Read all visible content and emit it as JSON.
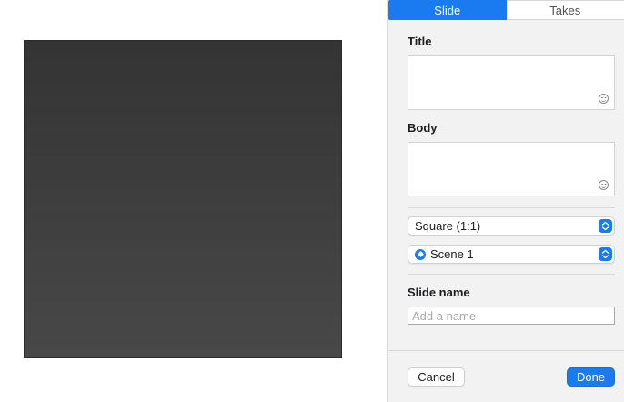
{
  "tabs": [
    {
      "label": "Slide",
      "active": true
    },
    {
      "label": "Takes",
      "active": false
    }
  ],
  "title_section": {
    "label": "Title",
    "value": ""
  },
  "body_section": {
    "label": "Body",
    "value": ""
  },
  "aspect_popup": {
    "value": "Square (1:1)"
  },
  "scene_popup": {
    "value": "Scene 1"
  },
  "slide_name": {
    "label": "Slide name",
    "value": "",
    "placeholder": "Add a name"
  },
  "footer": {
    "cancel_label": "Cancel",
    "done_label": "Done"
  },
  "icons": {
    "emoji": "smiley-face-icon",
    "stepper": "up-down-chevron-icon",
    "scene": "scene-diamond-icon"
  },
  "colors": {
    "accent": "#1a7bf0",
    "slide_top": "#343434",
    "slide_bottom": "#484848",
    "panel_bg": "#f2f2f2"
  }
}
